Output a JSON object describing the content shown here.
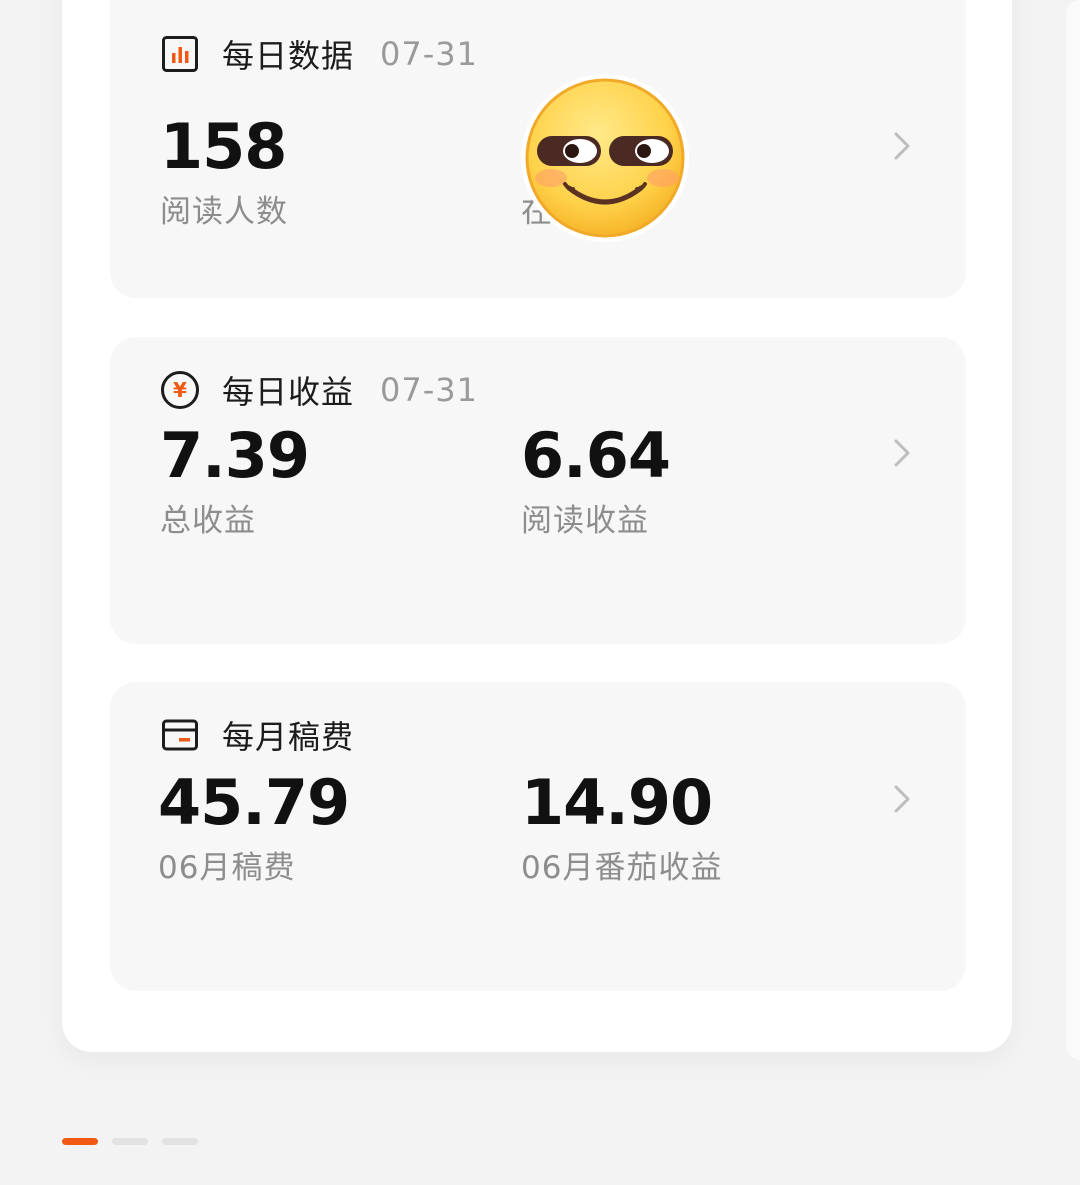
{
  "daily_data": {
    "title": "每日数据",
    "date": "07-31",
    "stats": [
      {
        "value": "158",
        "label": "阅读人数"
      },
      {
        "value": "",
        "label": "在"
      }
    ]
  },
  "daily_income": {
    "title": "每日收益",
    "date": "07-31",
    "stats": [
      {
        "value": "7.39",
        "label": "总收益"
      },
      {
        "value": "6.64",
        "label": "阅读收益"
      }
    ]
  },
  "monthly_fee": {
    "title": "每月稿费",
    "stats": [
      {
        "value": "45.79",
        "label": "06月稿费"
      },
      {
        "value": "14.90",
        "label": "06月番茄收益"
      }
    ]
  },
  "icons": {
    "daily_data": "bar-chart-icon",
    "daily_income": "yen-coin-icon",
    "monthly_fee": "card-icon",
    "chevron": "chevron-right-icon",
    "overlay": "smirk-emoji-sticker"
  },
  "colors": {
    "accent": "#f05a14",
    "card_bg": "#f7f7f7",
    "label": "#8d8d8d"
  },
  "pagination": {
    "count": 3,
    "active": 0
  }
}
